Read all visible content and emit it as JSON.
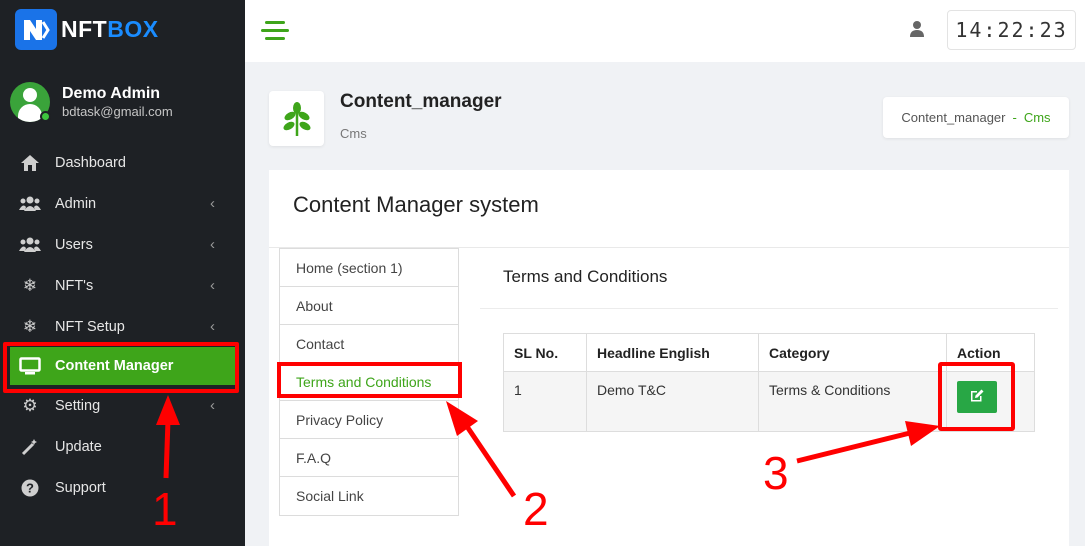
{
  "brand": {
    "name_part1": "NFT",
    "name_part2": "BOX",
    "logo_color": "#1a73e8"
  },
  "user": {
    "name": "Demo Admin",
    "email": "bdtask@gmail.com"
  },
  "sidebar": {
    "items": [
      {
        "label": "Dashboard",
        "icon": "home-icon",
        "has_submenu": false
      },
      {
        "label": "Admin",
        "icon": "users-icon",
        "has_submenu": true
      },
      {
        "label": "Users",
        "icon": "users-icon",
        "has_submenu": true
      },
      {
        "label": "NFT's",
        "icon": "snowflake-icon",
        "has_submenu": true
      },
      {
        "label": "NFT Setup",
        "icon": "snowflake-icon",
        "has_submenu": true
      },
      {
        "label": "Content Manager",
        "icon": "monitor-icon",
        "has_submenu": false,
        "active": true
      },
      {
        "label": "Setting",
        "icon": "gear-icon",
        "has_submenu": true
      },
      {
        "label": "Update",
        "icon": "magic-wand-icon",
        "has_submenu": false
      },
      {
        "label": "Support",
        "icon": "question-circle-icon",
        "has_submenu": false
      }
    ]
  },
  "topbar": {
    "clock": "14:22:23"
  },
  "page_header": {
    "title": "Content_manager",
    "subtitle": "Cms",
    "icon": "leaf-icon"
  },
  "breadcrumb": {
    "parent": "Content_manager",
    "separator": "-",
    "current": "Cms"
  },
  "card": {
    "title": "Content Manager system"
  },
  "tabs": [
    {
      "label": "Home (section 1)"
    },
    {
      "label": "About"
    },
    {
      "label": "Contact"
    },
    {
      "label": "Terms and Conditions",
      "active": true
    },
    {
      "label": "Privacy Policy"
    },
    {
      "label": "F.A.Q"
    },
    {
      "label": "Social Link"
    }
  ],
  "panel": {
    "title": "Terms and Conditions"
  },
  "table": {
    "headers": [
      "SL No.",
      "Headline English",
      "Category",
      "Action"
    ],
    "rows": [
      {
        "sl": "1",
        "headline": "Demo T&C",
        "category": "Terms & Conditions"
      }
    ]
  },
  "annotations": [
    "1",
    "2",
    "3"
  ],
  "colors": {
    "accent_green": "#3ea51a",
    "sidebar_bg": "#1e2125",
    "highlight_red": "#ff0000",
    "edit_button": "#28a745"
  }
}
